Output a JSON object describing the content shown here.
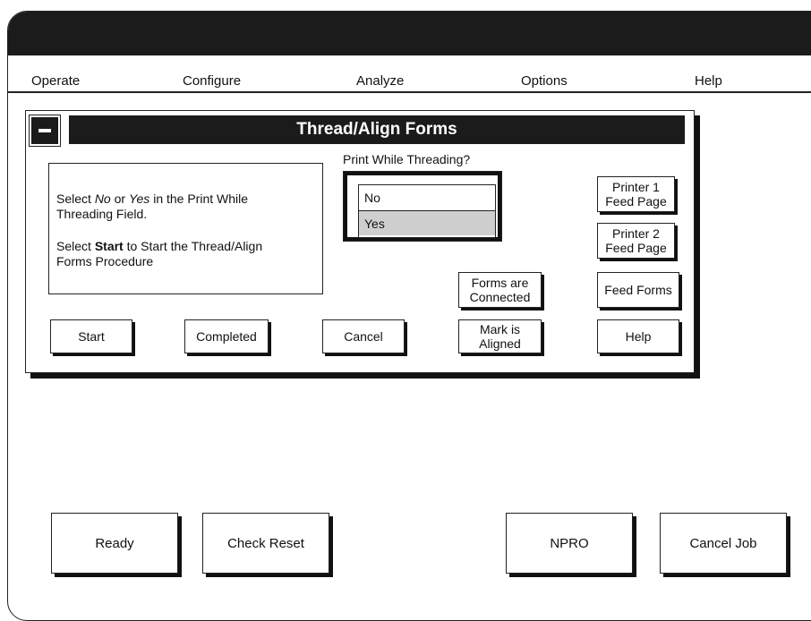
{
  "menu": {
    "operate": "Operate",
    "configure": "Configure",
    "analyze": "Analyze",
    "options": "Options",
    "help": "Help"
  },
  "dialog": {
    "title": "Thread/Align Forms",
    "instructions": {
      "line1_pre": "Select ",
      "line1_no": "No",
      "line1_or": " or ",
      "line1_yes": "Yes",
      "line1_post": " in the Print While",
      "line2": "Threading Field.",
      "line3_pre": "Select ",
      "line3_start": "Start",
      "line3_post": " to Start the Thread/Align",
      "line4": "Forms Procedure"
    },
    "threading": {
      "label": "Print While Threading?",
      "options": [
        "No",
        "Yes"
      ],
      "selected": "Yes"
    },
    "buttons": {
      "printer1_l1": "Printer 1",
      "printer1_l2": "Feed Page",
      "printer2_l1": "Printer 2",
      "printer2_l2": "Feed Page",
      "forms_l1": "Forms are",
      "forms_l2": "Connected",
      "feed_forms": "Feed Forms",
      "start": "Start",
      "completed": "Completed",
      "cancel": "Cancel",
      "mark_l1": "Mark is",
      "mark_l2": "Aligned",
      "help": "Help"
    }
  },
  "bottom": {
    "ready": "Ready",
    "check_reset": "Check Reset",
    "npro": "NPRO",
    "cancel_job": "Cancel Job"
  }
}
